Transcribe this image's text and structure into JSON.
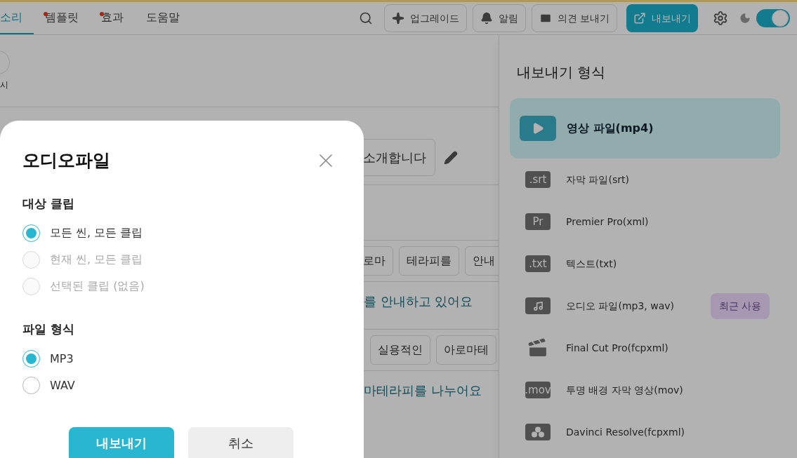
{
  "top_bar": {
    "tabs": [
      {
        "label": "소리",
        "selected": true,
        "new": false
      },
      {
        "label": "템플릿",
        "selected": false,
        "new": true
      },
      {
        "label": "효과",
        "selected": false,
        "new": true
      },
      {
        "label": "도움말",
        "selected": false,
        "new": false
      }
    ],
    "actions": [
      {
        "label": "업그레이드",
        "kind": "outline"
      },
      {
        "label": "알림",
        "kind": "outline"
      },
      {
        "label": "의견 보내기",
        "kind": "outline"
      },
      {
        "label": "내보내기",
        "kind": "primary"
      }
    ],
    "theme_toggle": {
      "on": true
    }
  },
  "background": {
    "side_label": "시",
    "title_chip": "소개합니다",
    "chip_rows": [
      [
        "로마",
        "테라피를",
        "안내"
      ],
      [
        "실용적인",
        "아로마테"
      ]
    ],
    "sentences": [
      "를 안내하고 있어요",
      "마테라피를 나누어요"
    ]
  },
  "export_panel": {
    "title": "내보내기 형식",
    "formats": [
      {
        "label": "영상 파일(mp4)",
        "kind": "video",
        "selected": true
      },
      {
        "label": "자막 파일(srt)",
        "kind": "tag",
        "tag": ".srt",
        "selected": false
      },
      {
        "label": "Premier Pro(xml)",
        "kind": "tag",
        "tag": "Pr",
        "selected": false
      },
      {
        "label": "텍스트(txt)",
        "kind": "tag",
        "tag": ".txt",
        "selected": false
      },
      {
        "label": "오디오 파일(mp3, wav)",
        "kind": "music",
        "badge": "최근 사용",
        "selected": false
      },
      {
        "label": "Final Cut Pro(fcpxml)",
        "kind": "clapper",
        "selected": false
      },
      {
        "label": "투명 배경 자막 영상(mov)",
        "kind": "tag",
        "tag": ".mov",
        "selected": false
      },
      {
        "label": "Davinci Resolve(fcpxml)",
        "kind": "circles",
        "selected": false
      }
    ]
  },
  "modal": {
    "title": "오디오파일",
    "sections": [
      {
        "heading": "대상 클립",
        "options": [
          {
            "label": "모든 씬, 모든 클립",
            "selected": true,
            "disabled": false
          },
          {
            "label": "현재 씬, 모든 클립",
            "selected": false,
            "disabled": true
          },
          {
            "label": "선택된 클립 (없음)",
            "selected": false,
            "disabled": true
          }
        ]
      },
      {
        "heading": "파일 형식",
        "options": [
          {
            "label": "MP3",
            "selected": true,
            "disabled": false
          },
          {
            "label": "WAV",
            "selected": false,
            "disabled": false
          }
        ]
      }
    ],
    "buttons": [
      {
        "label": "내보내기",
        "kind": "primary"
      },
      {
        "label": "취소",
        "kind": "secondary"
      }
    ]
  }
}
